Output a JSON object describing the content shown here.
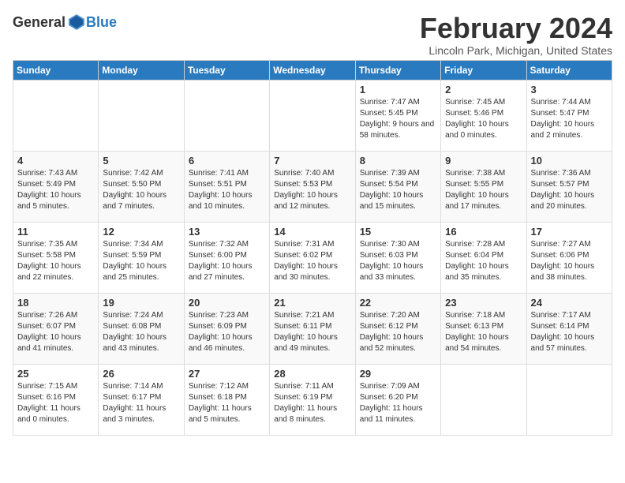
{
  "logo": {
    "general": "General",
    "blue": "Blue"
  },
  "title": "February 2024",
  "subtitle": "Lincoln Park, Michigan, United States",
  "headers": [
    "Sunday",
    "Monday",
    "Tuesday",
    "Wednesday",
    "Thursday",
    "Friday",
    "Saturday"
  ],
  "weeks": [
    [
      {
        "day": "",
        "info": ""
      },
      {
        "day": "",
        "info": ""
      },
      {
        "day": "",
        "info": ""
      },
      {
        "day": "",
        "info": ""
      },
      {
        "day": "1",
        "info": "Sunrise: 7:47 AM\nSunset: 5:45 PM\nDaylight: 9 hours and 58 minutes."
      },
      {
        "day": "2",
        "info": "Sunrise: 7:45 AM\nSunset: 5:46 PM\nDaylight: 10 hours and 0 minutes."
      },
      {
        "day": "3",
        "info": "Sunrise: 7:44 AM\nSunset: 5:47 PM\nDaylight: 10 hours and 2 minutes."
      }
    ],
    [
      {
        "day": "4",
        "info": "Sunrise: 7:43 AM\nSunset: 5:49 PM\nDaylight: 10 hours and 5 minutes."
      },
      {
        "day": "5",
        "info": "Sunrise: 7:42 AM\nSunset: 5:50 PM\nDaylight: 10 hours and 7 minutes."
      },
      {
        "day": "6",
        "info": "Sunrise: 7:41 AM\nSunset: 5:51 PM\nDaylight: 10 hours and 10 minutes."
      },
      {
        "day": "7",
        "info": "Sunrise: 7:40 AM\nSunset: 5:53 PM\nDaylight: 10 hours and 12 minutes."
      },
      {
        "day": "8",
        "info": "Sunrise: 7:39 AM\nSunset: 5:54 PM\nDaylight: 10 hours and 15 minutes."
      },
      {
        "day": "9",
        "info": "Sunrise: 7:38 AM\nSunset: 5:55 PM\nDaylight: 10 hours and 17 minutes."
      },
      {
        "day": "10",
        "info": "Sunrise: 7:36 AM\nSunset: 5:57 PM\nDaylight: 10 hours and 20 minutes."
      }
    ],
    [
      {
        "day": "11",
        "info": "Sunrise: 7:35 AM\nSunset: 5:58 PM\nDaylight: 10 hours and 22 minutes."
      },
      {
        "day": "12",
        "info": "Sunrise: 7:34 AM\nSunset: 5:59 PM\nDaylight: 10 hours and 25 minutes."
      },
      {
        "day": "13",
        "info": "Sunrise: 7:32 AM\nSunset: 6:00 PM\nDaylight: 10 hours and 27 minutes."
      },
      {
        "day": "14",
        "info": "Sunrise: 7:31 AM\nSunset: 6:02 PM\nDaylight: 10 hours and 30 minutes."
      },
      {
        "day": "15",
        "info": "Sunrise: 7:30 AM\nSunset: 6:03 PM\nDaylight: 10 hours and 33 minutes."
      },
      {
        "day": "16",
        "info": "Sunrise: 7:28 AM\nSunset: 6:04 PM\nDaylight: 10 hours and 35 minutes."
      },
      {
        "day": "17",
        "info": "Sunrise: 7:27 AM\nSunset: 6:06 PM\nDaylight: 10 hours and 38 minutes."
      }
    ],
    [
      {
        "day": "18",
        "info": "Sunrise: 7:26 AM\nSunset: 6:07 PM\nDaylight: 10 hours and 41 minutes."
      },
      {
        "day": "19",
        "info": "Sunrise: 7:24 AM\nSunset: 6:08 PM\nDaylight: 10 hours and 43 minutes."
      },
      {
        "day": "20",
        "info": "Sunrise: 7:23 AM\nSunset: 6:09 PM\nDaylight: 10 hours and 46 minutes."
      },
      {
        "day": "21",
        "info": "Sunrise: 7:21 AM\nSunset: 6:11 PM\nDaylight: 10 hours and 49 minutes."
      },
      {
        "day": "22",
        "info": "Sunrise: 7:20 AM\nSunset: 6:12 PM\nDaylight: 10 hours and 52 minutes."
      },
      {
        "day": "23",
        "info": "Sunrise: 7:18 AM\nSunset: 6:13 PM\nDaylight: 10 hours and 54 minutes."
      },
      {
        "day": "24",
        "info": "Sunrise: 7:17 AM\nSunset: 6:14 PM\nDaylight: 10 hours and 57 minutes."
      }
    ],
    [
      {
        "day": "25",
        "info": "Sunrise: 7:15 AM\nSunset: 6:16 PM\nDaylight: 11 hours and 0 minutes."
      },
      {
        "day": "26",
        "info": "Sunrise: 7:14 AM\nSunset: 6:17 PM\nDaylight: 11 hours and 3 minutes."
      },
      {
        "day": "27",
        "info": "Sunrise: 7:12 AM\nSunset: 6:18 PM\nDaylight: 11 hours and 5 minutes."
      },
      {
        "day": "28",
        "info": "Sunrise: 7:11 AM\nSunset: 6:19 PM\nDaylight: 11 hours and 8 minutes."
      },
      {
        "day": "29",
        "info": "Sunrise: 7:09 AM\nSunset: 6:20 PM\nDaylight: 11 hours and 11 minutes."
      },
      {
        "day": "",
        "info": ""
      },
      {
        "day": "",
        "info": ""
      }
    ]
  ]
}
